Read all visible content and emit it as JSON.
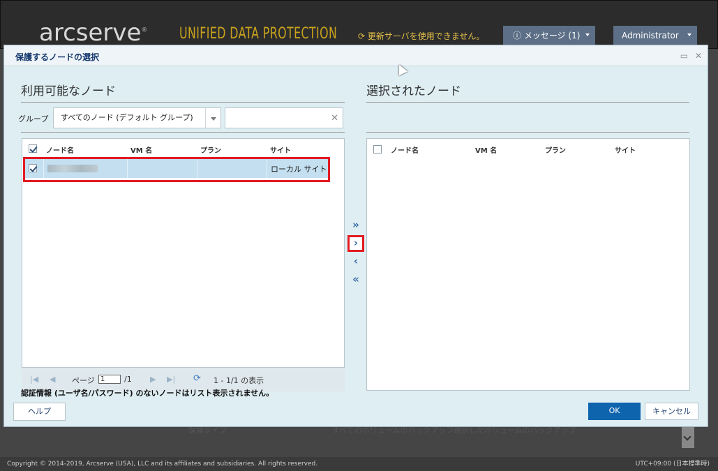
{
  "app": {
    "logo": "arcserve",
    "logo_mark": "®",
    "product": "UNIFIED DATA PROTECTION",
    "update_message": "更新サーバを使用できません。",
    "messages_button": "メッセージ (1)",
    "admin_button": "Administrator",
    "bg_label": "保護タイプ",
    "bg_option_all": "すべてのボリュームのバックアップ",
    "bg_option_selected": "選択したボリュームのバックアップ",
    "copyright": "Copyright © 2014-2019, Arcserve (USA), LLC and its affiliates and subsidiaries. All rights reserved.",
    "timezone": "UTC+09:00 (日本標準時)"
  },
  "dialog": {
    "title": "保護するノードの選択",
    "left_title": "利用可能なノード",
    "right_title": "選択されたノード",
    "group_label": "グループ",
    "group_value": "すべてのノード (デフォルト グループ)",
    "search_placeholder": "",
    "columns": [
      "ノード名",
      "VM 名",
      "プラン",
      "サイト"
    ],
    "rows": [
      {
        "node_name": "",
        "vm_name": "",
        "plan": "",
        "site": "ローカル サイト",
        "checked": true
      }
    ],
    "pager": {
      "page_label": "ページ",
      "page_value": "1",
      "page_total": "/1",
      "summary": "1 - 1/1 の表示"
    },
    "note": "認証情報 (ユーザ名/パスワード) のないノードはリスト表示されません。",
    "move_buttons": [
      "»",
      "›",
      "‹",
      "«"
    ],
    "help_button": "ヘルプ",
    "ok_button": "OK",
    "cancel_button": "キャンセル"
  },
  "colors": {
    "highlight": "#e21b23",
    "ok_blue": "#0f64ae",
    "dialog_bg": "#deeef3",
    "selected_row": "#c3dff0"
  }
}
